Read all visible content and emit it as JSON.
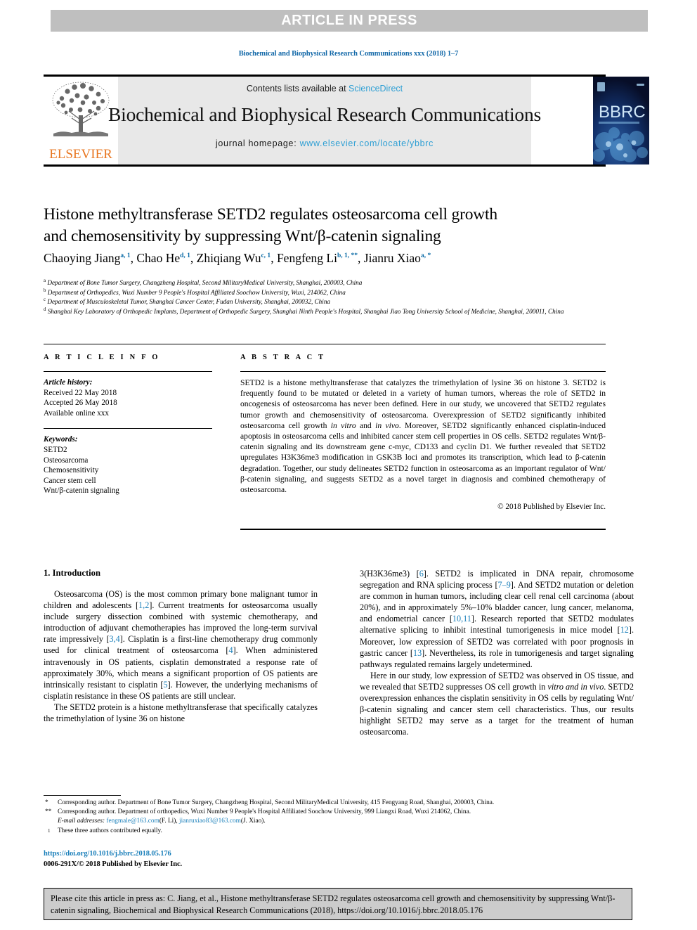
{
  "banner": {
    "text": "ARTICLE IN PRESS"
  },
  "running_head": "Biochemical and Biophysical Research Communications xxx (2018) 1–7",
  "masthead": {
    "contents_prefix": "Contents lists available at ",
    "contents_link": "ScienceDirect",
    "journal_name": "Biochemical and Biophysical Research Communications",
    "homepage_label": "journal homepage:",
    "homepage_url": "www.elsevier.com/locate/ybbrc",
    "publisher_logo_text": "ELSEVIER",
    "cover_logo_text": "BBRC"
  },
  "article": {
    "title_line1": "Histone methyltransferase SETD2 regulates osteosarcoma cell growth",
    "title_line2": "and chemosensitivity by suppressing Wnt/β-catenin signaling",
    "authors": [
      {
        "name": "Chaoying Jiang",
        "marks": "a, 1"
      },
      {
        "name": "Chao He",
        "marks": "d, 1"
      },
      {
        "name": "Zhiqiang Wu",
        "marks": "c, 1"
      },
      {
        "name": "Fengfeng Li",
        "marks": "b, 1, **"
      },
      {
        "name": "Jianru Xiao",
        "marks": "a, *"
      }
    ],
    "affiliations": [
      {
        "mark": "a",
        "text": "Department of Bone Tumor Surgery, Changzheng Hospital, Second MilitaryMedical University, Shanghai, 200003, China"
      },
      {
        "mark": "b",
        "text": "Department of Orthopedics, Wuxi Number 9 People's Hospital Affiliated Soochow University, Wuxi, 214062, China"
      },
      {
        "mark": "c",
        "text": "Department of Musculoskeletal Tumor, Shanghai Cancer Center, Fudan University, Shanghai, 200032, China"
      },
      {
        "mark": "d",
        "text": "Shanghai Key Laboratory of Orthopedic Implants, Department of Orthopedic Surgery, Shanghai Ninth People's Hospital, Shanghai Jiao Tong University School of Medicine, Shanghai, 200011, China"
      }
    ]
  },
  "article_info": {
    "heading": "A R T I C L E   I N F O",
    "history_label": "Article history:",
    "history": [
      "Received 22 May 2018",
      "Accepted 26 May 2018",
      "Available online xxx"
    ],
    "keywords_label": "Keywords:",
    "keywords": [
      "SETD2",
      "Osteosarcoma",
      "Chemosensitivity",
      "Cancer stem cell",
      "Wnt/β-catenin signaling"
    ]
  },
  "abstract": {
    "heading": "A B S T R A C T",
    "paragraph_1": "SETD2 is a histone methyltransferase that catalyzes the trimethylation of lysine 36 on histone 3. SETD2 is frequently found to be mutated or deleted in a variety of human tumors, whereas the role of SETD2 in oncogenesis of osteosarcoma has never been defined. Here in our study, we uncovered that SETD2 regulates tumor growth and chemosensitivity of osteosarcoma. Overexpression of SETD2 significantly inhibited osteosarcoma cell growth ",
    "italic_1": "in vitro",
    "paragraph_2": " and ",
    "italic_2": "in vivo",
    "paragraph_3": ". Moreover, SETD2 significantly enhanced cisplatin-induced apoptosis in osteosarcoma cells and inhibited cancer stem cell properties in OS cells. SETD2 regulates Wnt/β-catenin signaling and its downstream gene c-myc, CD133 and cyclin D1. We further revealed that SETD2 upregulates H3K36me3 modification in GSK3B loci and promotes its transcription, which lead to β-catenin degradation. Together, our study delineates SETD2 function in osteosarcoma as an important regulator of Wnt/β-catenin signaling, and suggests SETD2 as a novel target in diagnosis and combined chemotherapy of osteosarcoma.",
    "copyright": "© 2018 Published by Elsevier Inc."
  },
  "introduction": {
    "heading": "1.  Introduction",
    "left_para_1_a": "Osteosarcoma (OS) is the most common primary bone malignant tumor in children and adolescents [",
    "left_ref_1": "1,2",
    "left_para_1_b": "]. Current treatments for osteosarcoma usually include surgery dissection combined with systemic chemotherapy, and introduction of adjuvant chemotherapies has improved the long-term survival rate impressively [",
    "left_ref_2": "3,4",
    "left_para_1_c": "]. Cisplatin is a first-line chemotherapy drug commonly used for clinical treatment of osteosarcoma [",
    "left_ref_3": "4",
    "left_para_1_d": "]. When administered intravenously in OS patients, cisplatin demonstrated a response rate of approximately 30%, which means a significant proportion of OS patients are intrinsically resistant to cisplatin [",
    "left_ref_4": "5",
    "left_para_1_e": "]. However, the underlying mechanisms of cisplatin resistance in these OS patients are still unclear.",
    "left_para_2": "The SETD2 protein is a histone methyltransferase that specifically catalyzes the trimethylation of lysine 36 on histone",
    "right_para_1_a": "3(H3K36me3) [",
    "right_ref_1": "6",
    "right_para_1_b": "]. SETD2 is implicated in DNA repair, chromosome segregation and RNA splicing process [",
    "right_ref_2": "7–9",
    "right_para_1_c": "]. And SETD2 mutation or deletion are common in human tumors, including clear cell renal cell carcinoma (about 20%), and in approximately 5%–10% bladder cancer, lung cancer, melanoma, and endometrial cancer [",
    "right_ref_3": "10,11",
    "right_para_1_d": "]. Research reported that SETD2 modulates alternative splicing to inhibit intestinal tumorigenesis in mice model [",
    "right_ref_4": "12",
    "right_para_1_e": "]. Moreover, low expression of SETD2 was correlated with poor prognosis in gastric cancer [",
    "right_ref_5": "13",
    "right_para_1_f": "]. Nevertheless, its role in tumorigenesis and target signaling pathways regulated remains largely undetermined.",
    "right_para_2_a": "Here in our study, low expression of SETD2 was observed in OS tissue, and we revealed that SETD2 suppresses OS cell growth in ",
    "right_italic_1": "vitro and in vivo",
    "right_para_2_b": ". SETD2 overexpression enhances the cisplatin sensitivity in OS cells by regulating Wnt/β-catenin signaling and cancer stem cell characteristics. Thus, our results highlight SETD2 may serve as a target for the treatment of human osteosarcoma."
  },
  "footnotes": {
    "corr1_mark": "*",
    "corr1_text": "Corresponding author. Department of Bone Tumor Surgery, Changzheng Hospital, Second MilitaryMedical University, 415 Fengyang Road, Shanghai, 200003, China.",
    "corr2_mark": "**",
    "corr2_text": "Corresponding author. Department of orthopedics, Wuxi Number 9 People's Hospital Affiliated Soochow University, 999 Liangxi Road, Wuxi 214062, China.",
    "email_label": "E-mail addresses:",
    "email_1": "fengmale@163.com",
    "email_1_owner": "(F. Li),",
    "email_2": "jianruxiao83@163.com",
    "email_2_owner": "(J. Xiao).",
    "equal_mark": "1",
    "equal_text": "These three authors contributed equally.",
    "doi": "https://doi.org/10.1016/j.bbrc.2018.05.176",
    "issn": "0006-291X/© 2018 Published by Elsevier Inc."
  },
  "cite_box": {
    "text": "Please cite this article in press as: C. Jiang, et al., Histone methyltransferase SETD2 regulates osteosarcoma cell growth and chemosensitivity by suppressing Wnt/β-catenin signaling, Biochemical and Biophysical Research Communications (2018), https://doi.org/10.1016/j.bbrc.2018.05.176"
  },
  "colors": {
    "link_blue": "#1a7fba",
    "banner_gray": "#bfbfbf",
    "masthead_gray": "#e8e8e8",
    "elsevier_orange": "#e87722",
    "cite_box_gray": "#cccccc"
  }
}
